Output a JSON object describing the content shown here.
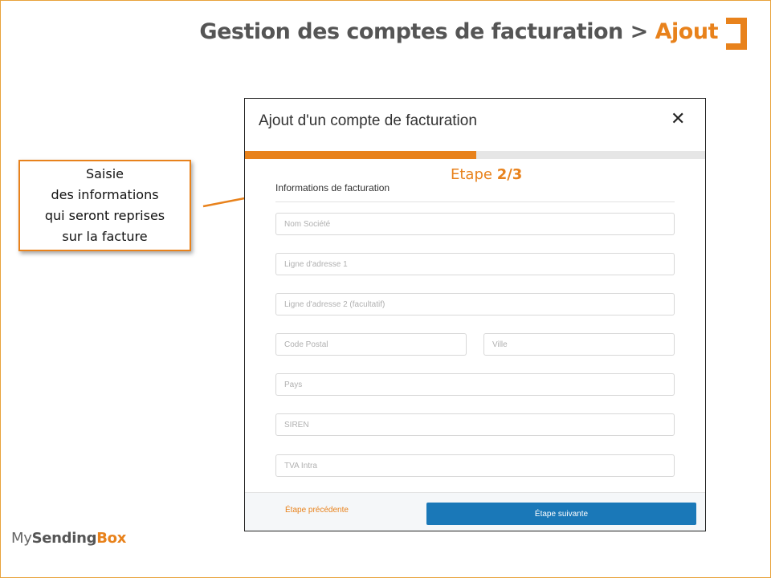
{
  "slide": {
    "title_main": "Gestion des comptes de facturation > ",
    "title_accent": "Ajout"
  },
  "callout": {
    "text": "Saisie\ndes informations\nqui seront reprises\nsur la facture"
  },
  "modal": {
    "title": "Ajout d'un compte de facturation",
    "close_symbol": "✕",
    "progress": 0.5,
    "step_prefix": "Etape ",
    "step_value": "2/3",
    "section_heading": "Informations de facturation",
    "fields": {
      "company": "Nom Société",
      "address1": "Ligne d'adresse 1",
      "address2": "Ligne d'adresse 2 (facultatif)",
      "postal_code": "Code Postal",
      "city": "Ville",
      "country": "Pays",
      "siren": "SIREN",
      "vat": "TVA Intra"
    },
    "footer": {
      "prev_label": "Étape précédente",
      "next_label": "Étape suivante"
    }
  },
  "logo": {
    "part1": "My",
    "part2": "Sending",
    "part3": "Box"
  },
  "colors": {
    "accent": "#e8821c",
    "primary_button": "#1a78b8",
    "title_gray": "#555555"
  }
}
